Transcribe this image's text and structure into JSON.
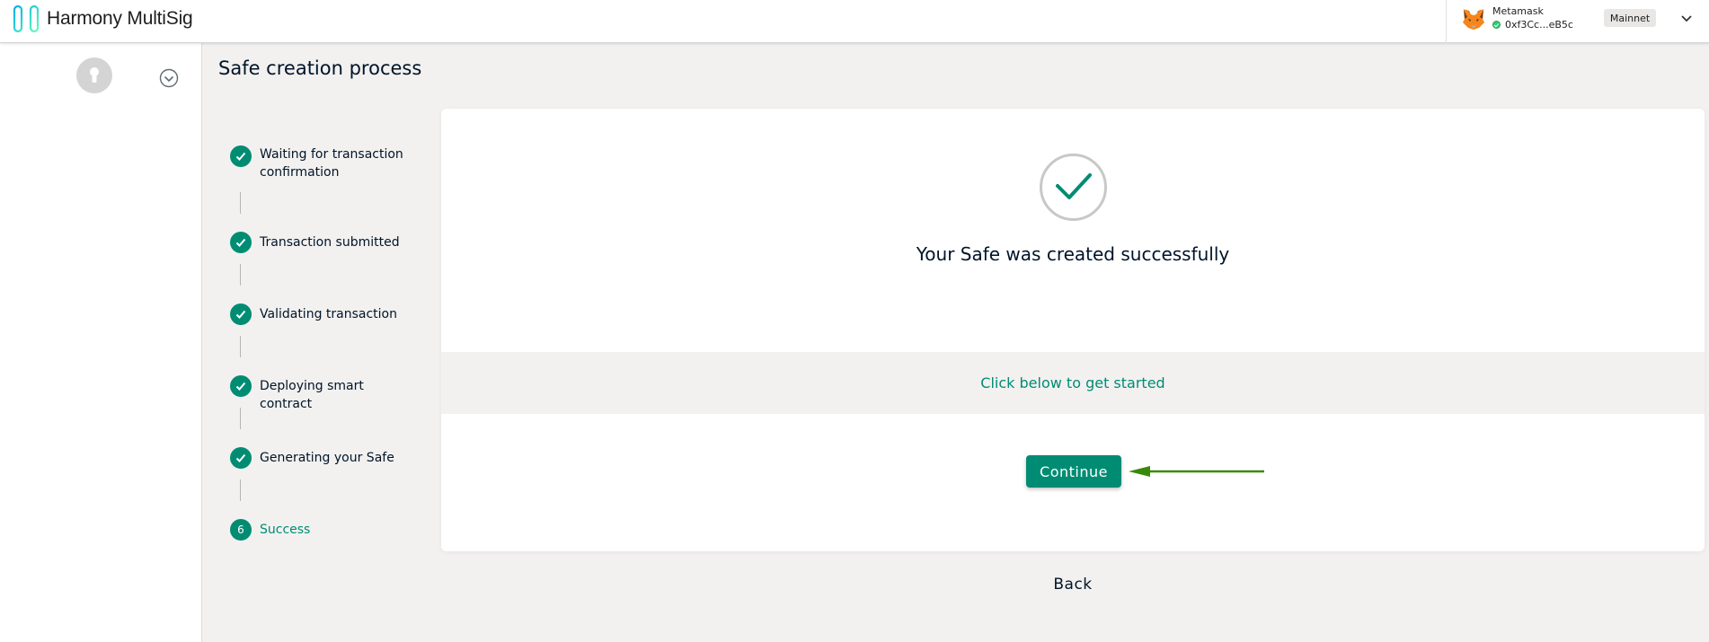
{
  "header": {
    "logo_text": "Harmony MultiSig",
    "logo_icon": "harmony-logo-icon",
    "provider": {
      "wallet_name": "Metamask",
      "address": "0xf3Cc...eB5c",
      "network": "Mainnet",
      "status": "connected",
      "wallet_icon": "metamask-fox-icon"
    }
  },
  "sidebar": {
    "avatar_icon": "keyhole-icon",
    "toggle_icon": "chevron-down-circle-icon"
  },
  "main": {
    "title": "Safe creation process",
    "steps": [
      {
        "label": "Waiting for transaction confirmation",
        "status": "done"
      },
      {
        "label": "Transaction submitted",
        "status": "done"
      },
      {
        "label": "Validating transaction",
        "status": "done"
      },
      {
        "label": "Deploying smart contract",
        "status": "done"
      },
      {
        "label": "Generating your Safe",
        "status": "done"
      },
      {
        "label": "Success",
        "status": "active",
        "number": "6"
      }
    ],
    "card": {
      "success_text": "Your Safe was created successfully",
      "hint": "Click below to get started",
      "continue_label": "Continue"
    },
    "back_label": "Back"
  },
  "colors": {
    "accent": "#008c73",
    "annotation_arrow": "#3a8a0a",
    "background": "#f2f1f0"
  }
}
